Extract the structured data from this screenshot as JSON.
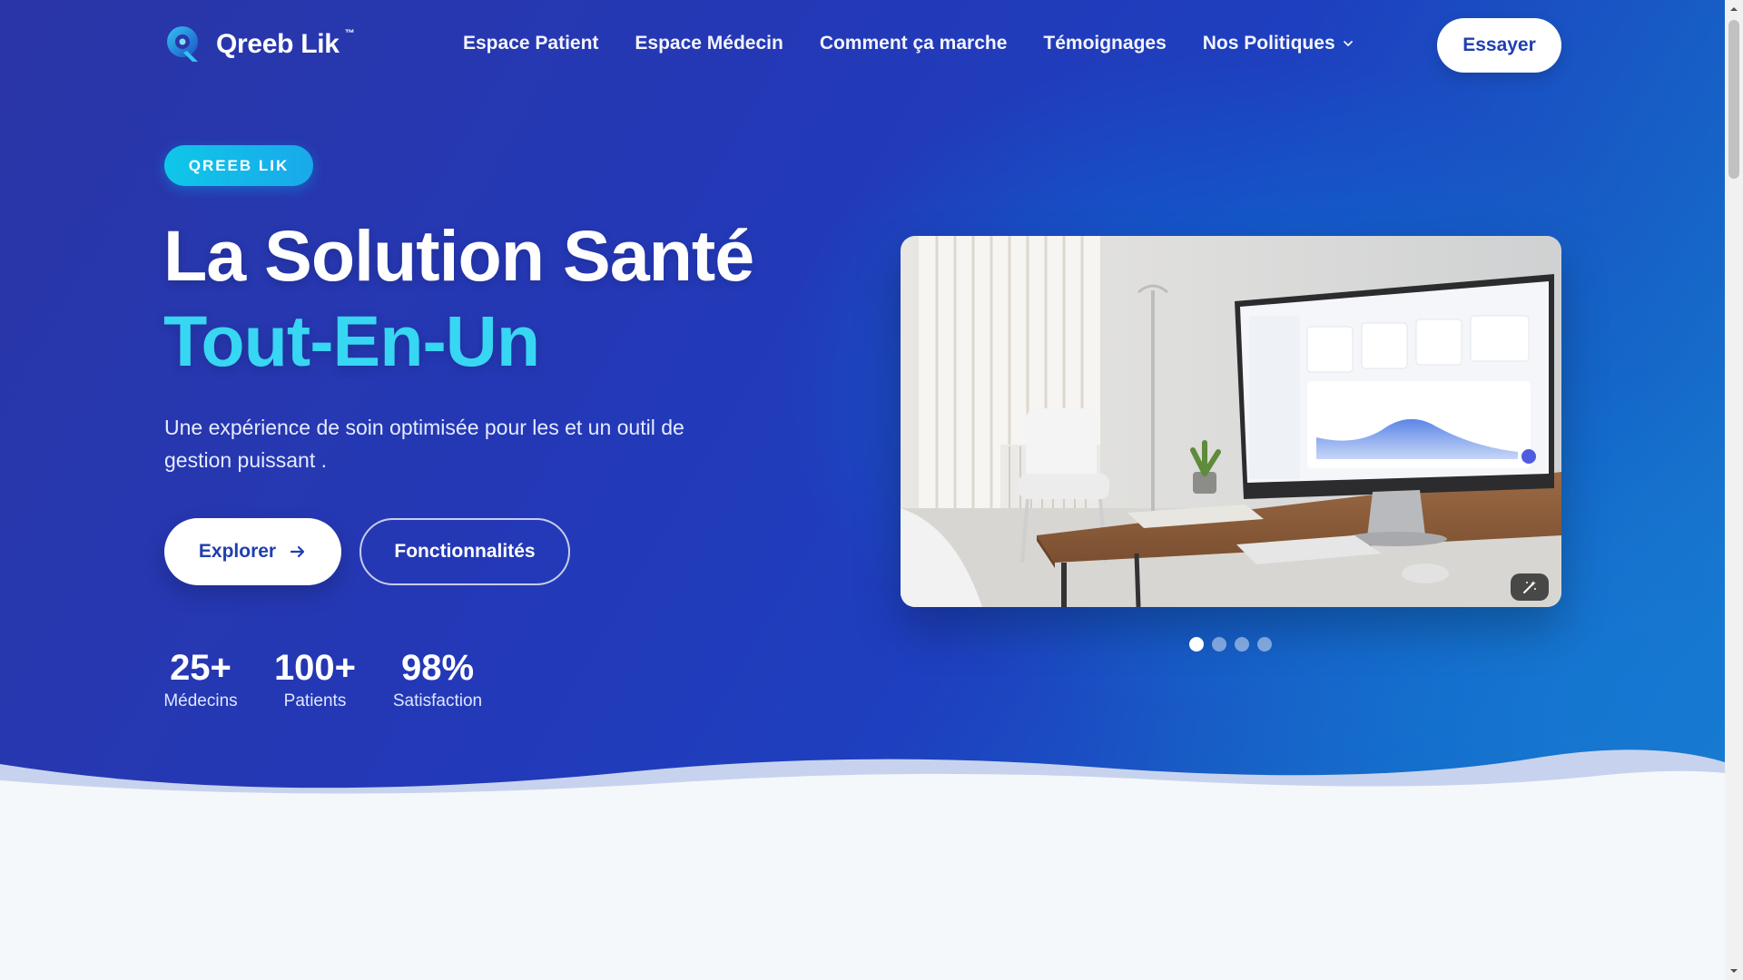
{
  "brand": {
    "name": "Qreeb Lik",
    "tm": "™"
  },
  "nav": {
    "links": [
      "Espace Patient",
      "Espace Médecin",
      "Comment ça marche",
      "Témoignages",
      "Nos Politiques"
    ],
    "cta": "Essayer"
  },
  "hero": {
    "badge": "QREEB LIK",
    "title_line1": "La Solution Santé",
    "title_line2": "Tout-En-Un",
    "subtitle": "Une expérience de soin optimisée pour les et un outil de gestion puissant .",
    "primary_button": "Explorer",
    "secondary_button": "Fonctionnalités",
    "stats": [
      {
        "value": "25+",
        "label": "Médecins"
      },
      {
        "value": "100+",
        "label": "Patients"
      },
      {
        "value": "98%",
        "label": "Satisfaction"
      }
    ]
  },
  "carousel": {
    "slides": 4,
    "active": 1
  },
  "colors": {
    "accent_cyan": "#37d6f2",
    "brand_blue": "#1f3fb0",
    "badge": "#0fc7e8"
  }
}
